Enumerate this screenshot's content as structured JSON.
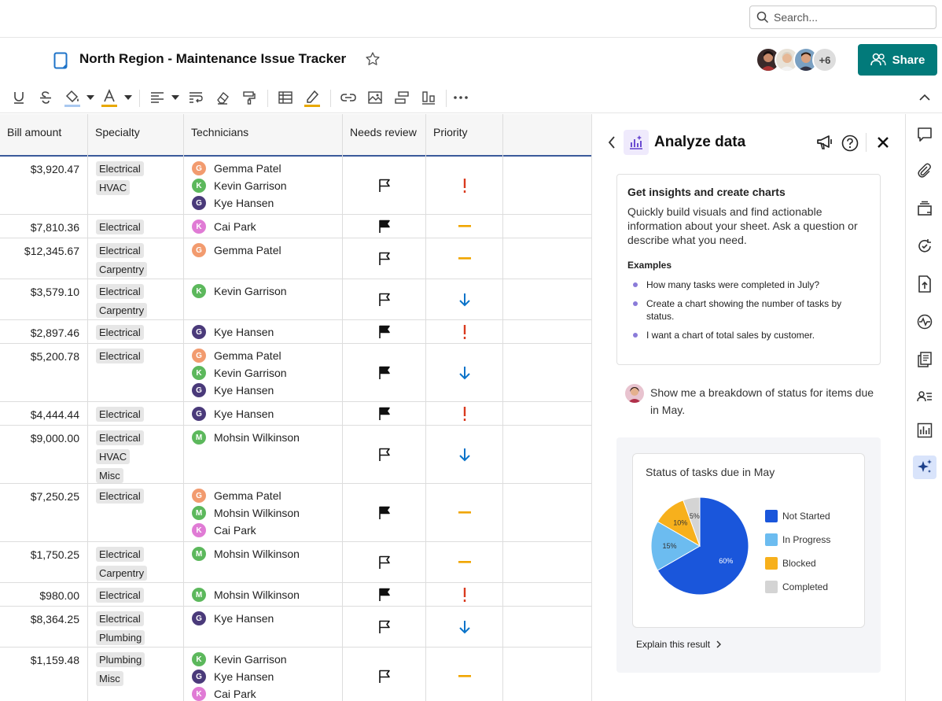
{
  "search": {
    "placeholder": "Search..."
  },
  "header": {
    "title": "North Region - Maintenance Issue Tracker",
    "more_collaborators": "+6",
    "share_label": "Share"
  },
  "grid": {
    "columns": [
      "Bill amount",
      "Specialty",
      "Technicians",
      "Needs review",
      "Priority"
    ],
    "rows": [
      {
        "amount": "$3,920.47",
        "specialties": [
          "Electrical",
          "HVAC"
        ],
        "techs": [
          {
            "i": "G",
            "name": "Gemma Patel"
          },
          {
            "i": "K",
            "name": "Kevin Garrison"
          },
          {
            "i": "G",
            "name": "Kye Hansen"
          }
        ],
        "review": "outline",
        "priority": "high"
      },
      {
        "amount": "$7,810.36",
        "specialties": [
          "Electrical"
        ],
        "techs": [
          {
            "i": "K",
            "name": "Cai Park"
          }
        ],
        "review": "filled",
        "priority": "medium"
      },
      {
        "amount": "$12,345.67",
        "specialties": [
          "Electrical",
          "Carpentry"
        ],
        "techs": [
          {
            "i": "G",
            "name": "Gemma Patel"
          }
        ],
        "review": "outline",
        "priority": "medium"
      },
      {
        "amount": "$3,579.10",
        "specialties": [
          "Electrical",
          "Carpentry"
        ],
        "techs": [
          {
            "i": "K",
            "name": "Kevin Garrison"
          }
        ],
        "review": "outline",
        "priority": "low"
      },
      {
        "amount": "$2,897.46",
        "specialties": [
          "Electrical"
        ],
        "techs": [
          {
            "i": "G",
            "name": "Kye Hansen"
          }
        ],
        "review": "filled",
        "priority": "high"
      },
      {
        "amount": "$5,200.78",
        "specialties": [
          "Electrical"
        ],
        "techs": [
          {
            "i": "G",
            "name": "Gemma Patel"
          },
          {
            "i": "K",
            "name": "Kevin Garrison"
          },
          {
            "i": "G",
            "name": "Kye Hansen"
          }
        ],
        "review": "filled",
        "priority": "low"
      },
      {
        "amount": "$4,444.44",
        "specialties": [
          "Electrical"
        ],
        "techs": [
          {
            "i": "G",
            "name": "Kye Hansen"
          }
        ],
        "review": "filled",
        "priority": "high"
      },
      {
        "amount": "$9,000.00",
        "specialties": [
          "Electrical",
          "HVAC",
          "Misc"
        ],
        "techs": [
          {
            "i": "M",
            "name": "Mohsin Wilkinson"
          }
        ],
        "review": "outline",
        "priority": "low"
      },
      {
        "amount": "$7,250.25",
        "specialties": [
          "Electrical"
        ],
        "techs": [
          {
            "i": "G",
            "name": "Gemma Patel"
          },
          {
            "i": "M",
            "name": "Mohsin Wilkinson"
          },
          {
            "i": "K",
            "name": "Cai Park"
          }
        ],
        "review": "filled",
        "priority": "medium"
      },
      {
        "amount": "$1,750.25",
        "specialties": [
          "Electrical",
          "Carpentry"
        ],
        "techs": [
          {
            "i": "M",
            "name": "Mohsin Wilkinson"
          }
        ],
        "review": "outline",
        "priority": "medium"
      },
      {
        "amount": "$980.00",
        "specialties": [
          "Electrical"
        ],
        "techs": [
          {
            "i": "M",
            "name": "Mohsin Wilkinson"
          }
        ],
        "review": "filled",
        "priority": "high"
      },
      {
        "amount": "$8,364.25",
        "specialties": [
          "Electrical",
          "Plumbing"
        ],
        "techs": [
          {
            "i": "G",
            "name": "Kye Hansen"
          }
        ],
        "review": "outline",
        "priority": "low"
      },
      {
        "amount": "$1,159.48",
        "specialties": [
          "Plumbing",
          "Misc"
        ],
        "techs": [
          {
            "i": "K",
            "name": "Kevin Garrison"
          },
          {
            "i": "G",
            "name": "Kye Hansen"
          },
          {
            "i": "K",
            "name": "Cai Park"
          }
        ],
        "review": "outline",
        "priority": "medium"
      }
    ]
  },
  "tech_colors": {
    "Gemma Patel": "#f29b6f",
    "Kevin Garrison": "#5cb85c",
    "Kye Hansen": "#4a3a7a",
    "Cai Park": "#e07bd5",
    "Mohsin Wilkinson": "#5cb85c"
  },
  "priority_colors": {
    "high": "#d93a1f",
    "medium": "#f0a500",
    "low": "#0a73c9"
  },
  "panel": {
    "title": "Analyze data",
    "insights_title": "Get insights and create charts",
    "insights_body": "Quickly build visuals and find actionable information about your sheet. Ask a question or describe what you need.",
    "examples_label": "Examples",
    "examples": [
      "How many tasks were completed in July?",
      "Create a chart showing the number of tasks by status.",
      "I want a chart of total sales by customer."
    ],
    "user_message": "Show me a breakdown of status for items due in May.",
    "explain_label": "Explain this result"
  },
  "chart_data": {
    "type": "pie",
    "title": "Status of tasks due in May",
    "categories": [
      "Not Started",
      "In Progress",
      "Blocked",
      "Completed"
    ],
    "values": [
      60,
      15,
      10,
      5
    ],
    "labels": [
      "60%",
      "15%",
      "10%",
      "5%"
    ],
    "colors": [
      "#1a56db",
      "#6cbcf0",
      "#f7b01c",
      "#d4d4d4"
    ],
    "legend": "right"
  }
}
